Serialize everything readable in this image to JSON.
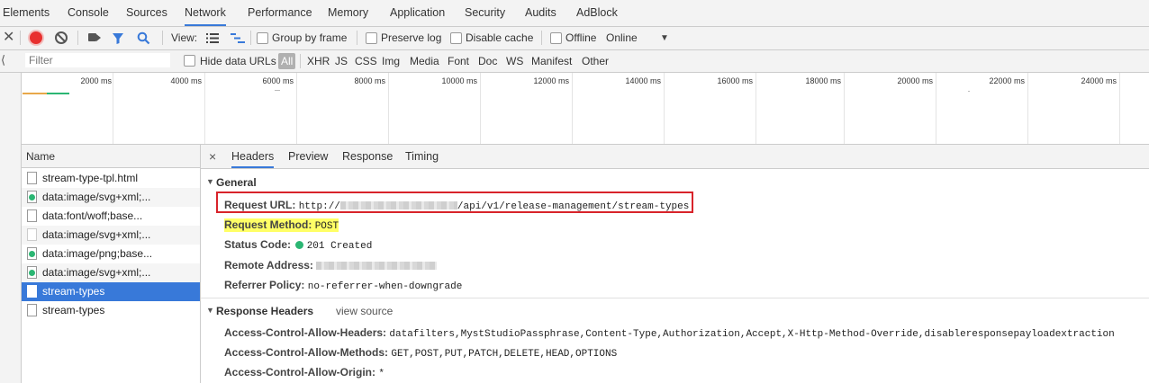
{
  "tabs": [
    {
      "label": "Elements"
    },
    {
      "label": "Console"
    },
    {
      "label": "Sources"
    },
    {
      "label": "Network"
    },
    {
      "label": "Performance"
    },
    {
      "label": "Memory"
    },
    {
      "label": "Application"
    },
    {
      "label": "Security"
    },
    {
      "label": "Audits"
    },
    {
      "label": "AdBlock"
    }
  ],
  "active_tab": "Network",
  "toolbar": {
    "view_label": "View:",
    "group_by_frame": "Group by frame",
    "preserve_log": "Preserve log",
    "disable_cache": "Disable cache",
    "offline": "Offline",
    "throttle_value": "Online"
  },
  "filterbar": {
    "placeholder": "Filter",
    "hide_data_urls": "Hide data URLs",
    "types": [
      "All",
      "XHR",
      "JS",
      "CSS",
      "Img",
      "Media",
      "Font",
      "Doc",
      "WS",
      "Manifest",
      "Other"
    ]
  },
  "timeline": {
    "ticks": [
      "2000 ms",
      "4000 ms",
      "6000 ms",
      "8000 ms",
      "10000 ms",
      "12000 ms",
      "14000 ms",
      "16000 ms",
      "18000 ms",
      "20000 ms",
      "22000 ms",
      "24000 ms"
    ]
  },
  "name_column": {
    "header": "Name",
    "rows": [
      {
        "label": "stream-type-tpl.html",
        "icon": "file-icon"
      },
      {
        "label": "data:image/svg+xml;...",
        "icon": "image-file-icon"
      },
      {
        "label": "data:font/woff;base...",
        "icon": "file-icon"
      },
      {
        "label": "data:image/svg+xml;...",
        "icon": "file-icon"
      },
      {
        "label": "data:image/png;base...",
        "icon": "image-file-icon"
      },
      {
        "label": "data:image/svg+xml;...",
        "icon": "image-file-icon"
      },
      {
        "label": "stream-types",
        "icon": "file-icon",
        "selected": true
      },
      {
        "label": "stream-types",
        "icon": "file-icon"
      }
    ]
  },
  "details": {
    "tabs": [
      "Headers",
      "Preview",
      "Response",
      "Timing"
    ],
    "active_tab": "Headers",
    "general": {
      "title": "General",
      "request_url_key": "Request URL:",
      "request_url_prefix": "http://",
      "request_url_path": "/api/v1/release-management/stream-types",
      "request_method_key": "Request Method:",
      "request_method": "POST",
      "status_code_key": "Status Code:",
      "status_code": "201 Created",
      "remote_address_key": "Remote Address:",
      "referrer_policy_key": "Referrer Policy:",
      "referrer_policy": "no-referrer-when-downgrade"
    },
    "response_headers": {
      "title": "Response Headers",
      "view_source": "view source",
      "items": [
        {
          "key": "Access-Control-Allow-Headers:",
          "value": "datafilters,MystStudioPassphrase,Content-Type,Authorization,Accept,X-Http-Method-Override,disableresponsepayloadextraction"
        },
        {
          "key": "Access-Control-Allow-Methods:",
          "value": "GET,POST,PUT,PATCH,DELETE,HEAD,OPTIONS"
        },
        {
          "key": "Access-Control-Allow-Origin:",
          "value": "*"
        }
      ]
    }
  },
  "colors": {
    "accent": "#3879d9",
    "record": "#e8302f",
    "status_ok": "#2bb673",
    "highlight": "#ffff66",
    "callout": "#d8232a"
  }
}
